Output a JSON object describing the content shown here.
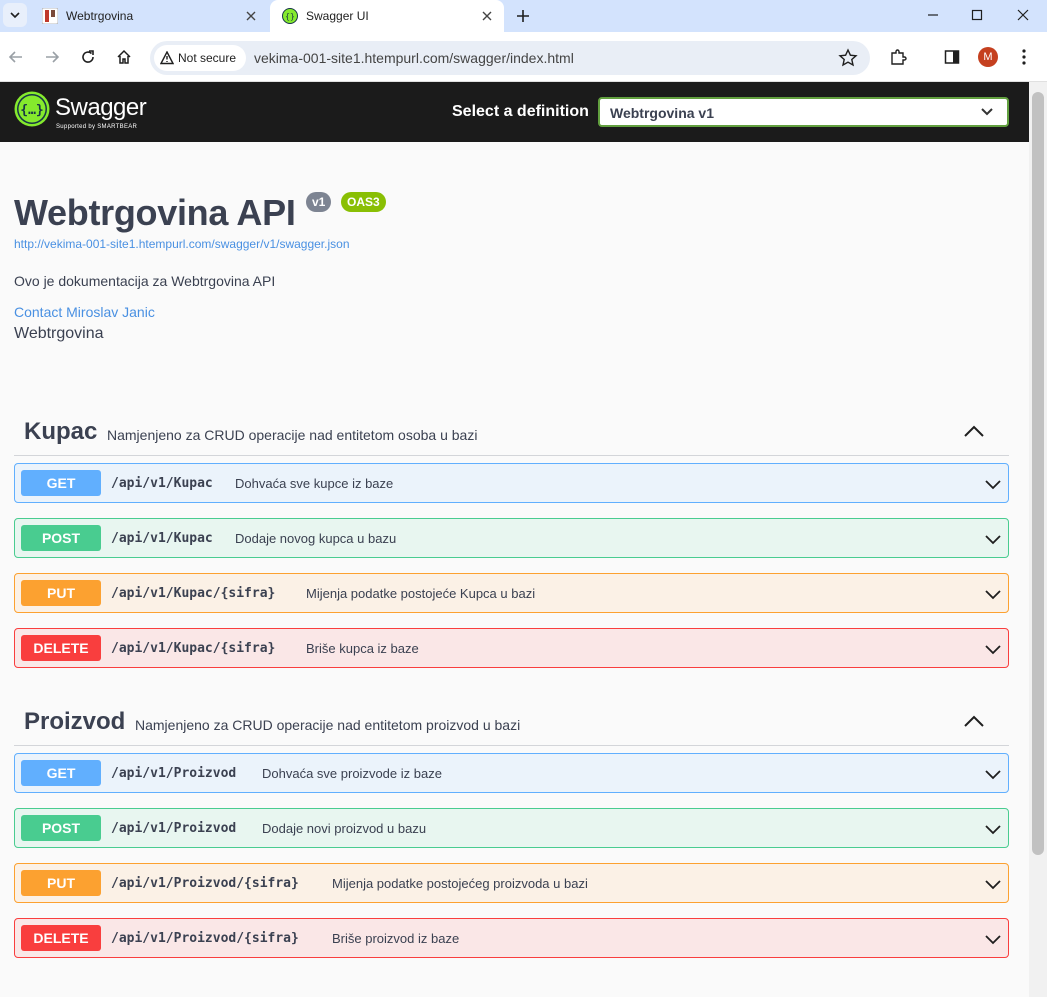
{
  "browser": {
    "tabs": [
      {
        "title": "Webtrgovina",
        "active": false
      },
      {
        "title": "Swagger UI",
        "active": true
      }
    ],
    "security_label": "Not secure",
    "url": "vekima-001-site1.htempurl.com/swagger/index.html",
    "profile_initial": "M"
  },
  "topbar": {
    "brand": "Swagger",
    "brand_sub": "Supported by SMARTBEAR",
    "select_label": "Select a definition",
    "selected_definition": "Webtrgovina v1"
  },
  "info": {
    "title": "Webtrgovina API",
    "version_badge": "v1",
    "oas_badge": "OAS3",
    "spec_url": "http://vekima-001-site1.htempurl.com/swagger/v1/swagger.json",
    "description": "Ovo je dokumentacija za Webtrgovina API",
    "contact": "Contact Miroslav Janic",
    "license": "Webtrgovina"
  },
  "tags": [
    {
      "name": "Kupac",
      "description": "Namjenjeno za CRUD operacije nad entitetom osoba u bazi",
      "operations": [
        {
          "method": "GET",
          "path": "/api/v1/Kupac",
          "summary": "Dohvaća sve kupce iz baze"
        },
        {
          "method": "POST",
          "path": "/api/v1/Kupac",
          "summary": "Dodaje novog kupca u bazu"
        },
        {
          "method": "PUT",
          "path": "/api/v1/Kupac/{sifra}",
          "summary": "Mijenja podatke postojeće Kupca u bazi"
        },
        {
          "method": "DELETE",
          "path": "/api/v1/Kupac/{sifra}",
          "summary": "Briše kupca iz baze"
        }
      ]
    },
    {
      "name": "Proizvod",
      "description": "Namjenjeno za CRUD operacije nad entitetom proizvod u bazi",
      "operations": [
        {
          "method": "GET",
          "path": "/api/v1/Proizvod",
          "summary": "Dohvaća sve proizvode iz baze"
        },
        {
          "method": "POST",
          "path": "/api/v1/Proizvod",
          "summary": "Dodaje novi proizvod u bazu"
        },
        {
          "method": "PUT",
          "path": "/api/v1/Proizvod/{sifra}",
          "summary": "Mijenja podatke postojećeg proizvoda u bazi"
        },
        {
          "method": "DELETE",
          "path": "/api/v1/Proizvod/{sifra}",
          "summary": "Briše proizvod iz baze"
        }
      ]
    }
  ],
  "colors": {
    "get": "#61affe",
    "post": "#49cc90",
    "put": "#fca130",
    "delete": "#f93e3e",
    "link": "#4990e2",
    "topbar": "#1b1b1b",
    "swagger_green": "#85ea2d"
  }
}
